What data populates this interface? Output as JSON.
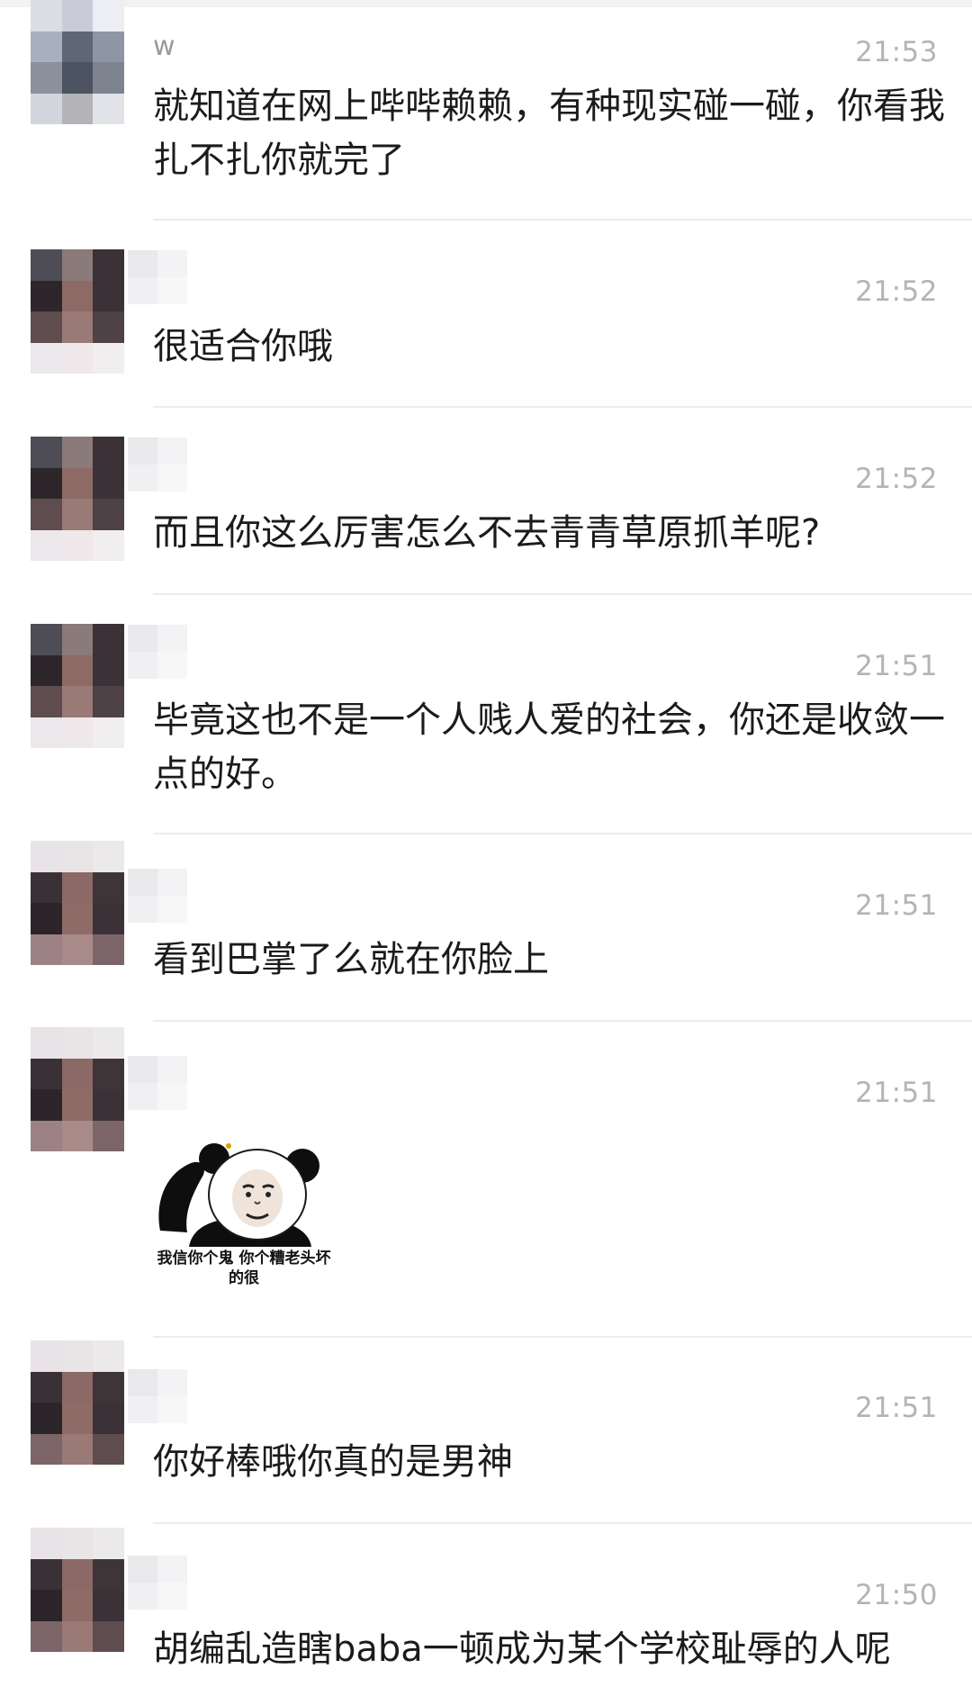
{
  "messages": [
    {
      "nickname": "w",
      "time": "21:53",
      "text": "就知道在网上哔哔赖赖，有种现实碰一碰，你看我扎不扎你就完了"
    },
    {
      "nickname": "",
      "time": "21:52",
      "text": "很适合你哦"
    },
    {
      "nickname": "",
      "time": "21:52",
      "text": "而且你这么厉害怎么不去青青草原抓羊呢?"
    },
    {
      "nickname": "",
      "time": "21:51",
      "text": "毕竟这也不是一个人贱人爱的社会，你还是收敛一点的好。"
    },
    {
      "nickname": "",
      "time": "21:51",
      "text": "看到巴掌了么就在你脸上"
    },
    {
      "nickname": "",
      "time": "21:51",
      "text": "",
      "sticker": {
        "icon": "panda-meme-sticker",
        "caption": "我信你个鬼 你个糟老头坏的很"
      }
    },
    {
      "nickname": "",
      "time": "21:51",
      "text": "你好棒哦你真的是男神"
    },
    {
      "nickname": "",
      "time": "21:50",
      "text": "胡编乱造瞎baba一顿成为某个学校耻辱的人呢"
    }
  ],
  "colors": {
    "time": "#b4b4b4",
    "text": "#1b1b1b",
    "divider": "#ececec",
    "avatar_blur": [
      "#5a5a66",
      "#3e353a",
      "#8f6b68",
      "#b8b6bf",
      "#2f2a2e",
      "#7c5f5d"
    ]
  }
}
